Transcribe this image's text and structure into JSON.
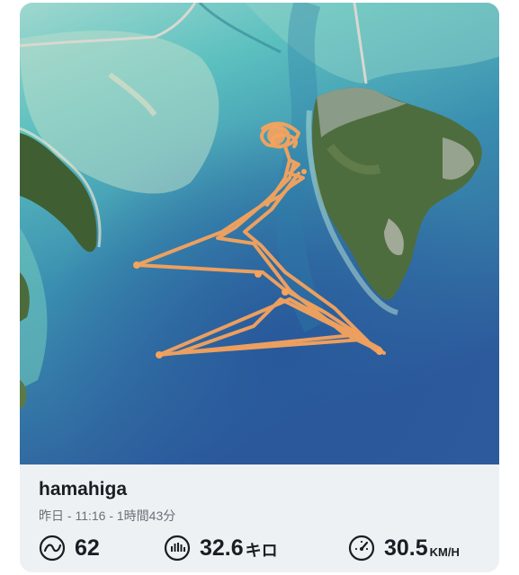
{
  "activity": {
    "title": "hamahiga",
    "subtitle": "昨日 - 11:16 - 1時間43分"
  },
  "stats": {
    "laps": {
      "value": "62",
      "icon": "wave-lap-icon"
    },
    "distance": {
      "value": "32.6",
      "unit": "キロ",
      "icon": "speed-bars-icon"
    },
    "speed": {
      "value": "30.5",
      "unit": "KM/H",
      "icon": "speedometer-icon"
    }
  },
  "colors": {
    "track": "#f7a35c",
    "sea_light": "#5fc1c0",
    "sea_deep": "#2a5fa0",
    "land": "#4c6b3c",
    "footer_bg": "#eef1f4"
  }
}
